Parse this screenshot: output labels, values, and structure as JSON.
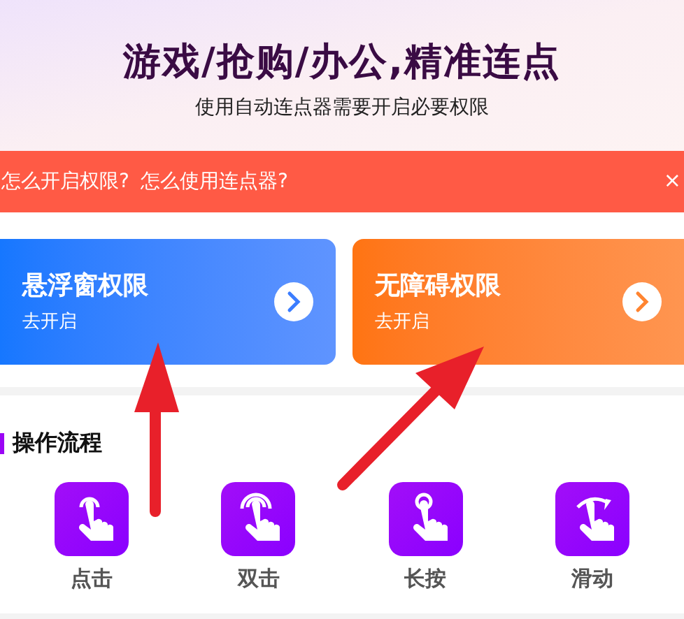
{
  "header": {
    "title": "游戏/抢购/办公,精准连点",
    "subtitle": "使用自动连点器需要开启必要权限"
  },
  "banner": {
    "links": [
      "怎么开启权限?",
      "怎么使用连点器?"
    ],
    "close": "×"
  },
  "permission_cards": [
    {
      "kind": "blue",
      "title": "悬浮窗权限",
      "action": "去开启"
    },
    {
      "kind": "orange",
      "title": "无障碍权限",
      "action": "去开启"
    }
  ],
  "section": {
    "title": "操作流程"
  },
  "gestures": [
    {
      "kind": "tap",
      "label": "点击"
    },
    {
      "kind": "double",
      "label": "双击"
    },
    {
      "kind": "long",
      "label": "长按"
    },
    {
      "kind": "swipe",
      "label": "滑动"
    }
  ]
}
